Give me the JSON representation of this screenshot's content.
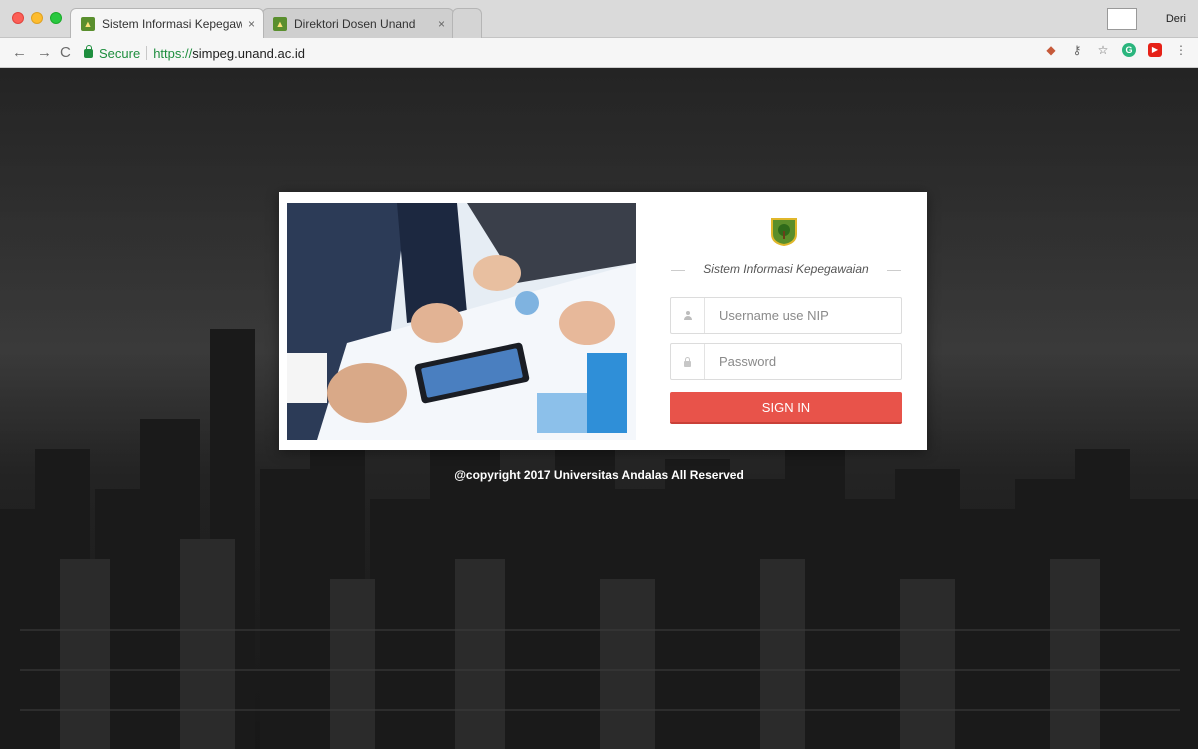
{
  "browser": {
    "tabs": [
      {
        "title": "Sistem Informasi Kepegawaian",
        "close": "×"
      },
      {
        "title": "Direktori Dosen Unand",
        "close": "×"
      }
    ],
    "profile_name": "Deri",
    "nav": {
      "back": "←",
      "forward": "→",
      "reload": "C"
    },
    "security_label": "Secure",
    "url_scheme": "https://",
    "url_host": "simpeg.unand.ac.id",
    "toolbar_icons": [
      "extension-icon",
      "key-icon",
      "star-icon",
      "grammarly-icon",
      "video-icon",
      "menu-icon"
    ]
  },
  "login": {
    "system_title": "Sistem Informasi Kepegawaian",
    "username_placeholder": "Username use NIP",
    "password_placeholder": "Password",
    "signin_label": "SIGN IN",
    "button_color": "#e8534a"
  },
  "footer": {
    "copyright": "@copyright 2017 Universitas Andalas All Reserved"
  }
}
